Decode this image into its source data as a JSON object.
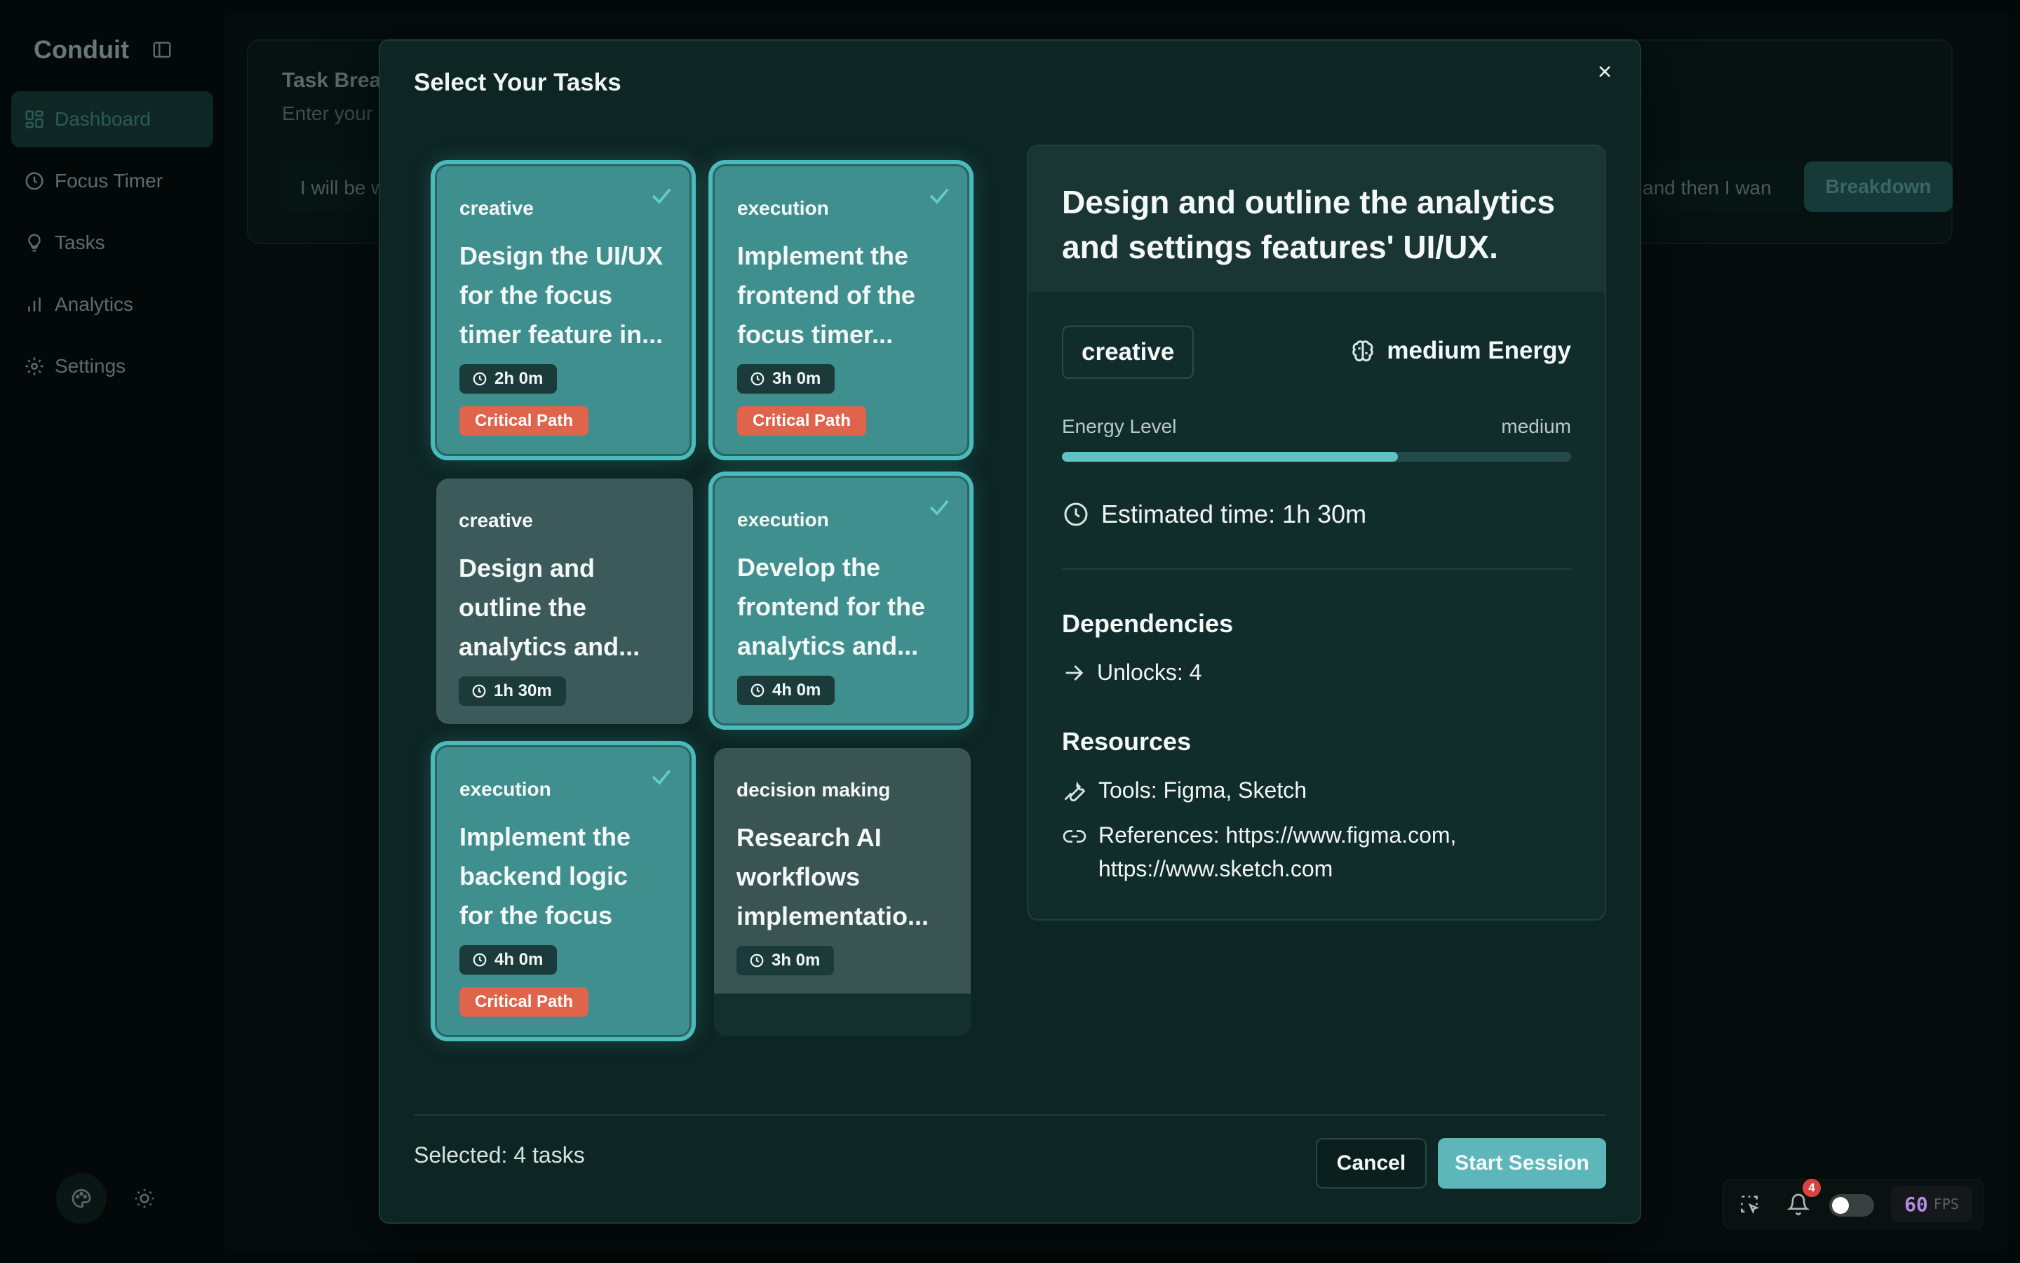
{
  "app": {
    "brand": "Conduit",
    "nav": [
      {
        "label": "Dashboard",
        "icon": "dashboard-icon",
        "active": true
      },
      {
        "label": "Focus Timer",
        "icon": "clock-icon",
        "active": false
      },
      {
        "label": "Tasks",
        "icon": "lightbulb-icon",
        "active": false
      },
      {
        "label": "Analytics",
        "icon": "bar-chart-icon",
        "active": false
      },
      {
        "label": "Settings",
        "icon": "gear-icon",
        "active": false
      }
    ],
    "background_card": {
      "title": "Task Brea",
      "subtitle": "Enter your",
      "input_left": "I will be w",
      "input_right": "and then I wan",
      "button": "Breakdown"
    }
  },
  "toolbar": {
    "notification_count": "4",
    "fps_value": "60",
    "fps_label": "FPS"
  },
  "modal": {
    "title": "Select Your Tasks",
    "tasks": [
      {
        "type": "creative",
        "title": "Design the UI/UX for the focus timer feature in...",
        "time": "2h 0m",
        "badge": "Critical Path",
        "selected": true
      },
      {
        "type": "execution",
        "title": "Implement the frontend of the focus timer...",
        "time": "3h 0m",
        "badge": "Critical Path",
        "selected": true
      },
      {
        "type": "creative",
        "title": "Design and outline the analytics and...",
        "time": "1h 30m",
        "badge": "",
        "selected": false
      },
      {
        "type": "execution",
        "title": "Develop the frontend for the analytics and...",
        "time": "4h 0m",
        "badge": "",
        "selected": true
      },
      {
        "type": "execution",
        "title": "Implement the backend logic for the focus timer...",
        "time": "4h 0m",
        "badge": "Critical Path",
        "selected": true
      },
      {
        "type": "decision making",
        "title": "Research AI workflows implementatio...",
        "time": "3h 0m",
        "badge": "",
        "selected": false
      }
    ],
    "detail": {
      "title": "Design and outline the analytics and settings features' UI/UX.",
      "type": "creative",
      "energy_badge": "medium Energy",
      "energy_label": "Energy Level",
      "energy_value": "medium",
      "energy_fraction": 0.66,
      "estimated_time": "Estimated time: 1h 30m",
      "dependencies_heading": "Dependencies",
      "unlocks": "Unlocks: 4",
      "resources_heading": "Resources",
      "tools": "Tools: Figma, Sketch",
      "references_line1": "References: https://www.figma.com,",
      "references_line2": "https://www.sketch.com"
    },
    "footer": {
      "selected_count": "Selected: 4 tasks",
      "cancel": "Cancel",
      "start": "Start Session"
    }
  },
  "colors": {
    "accent": "#5cb6ba",
    "critical": "#e0634c",
    "selected_card": "#3f8f8e",
    "modal_bg": "#0d2523"
  }
}
